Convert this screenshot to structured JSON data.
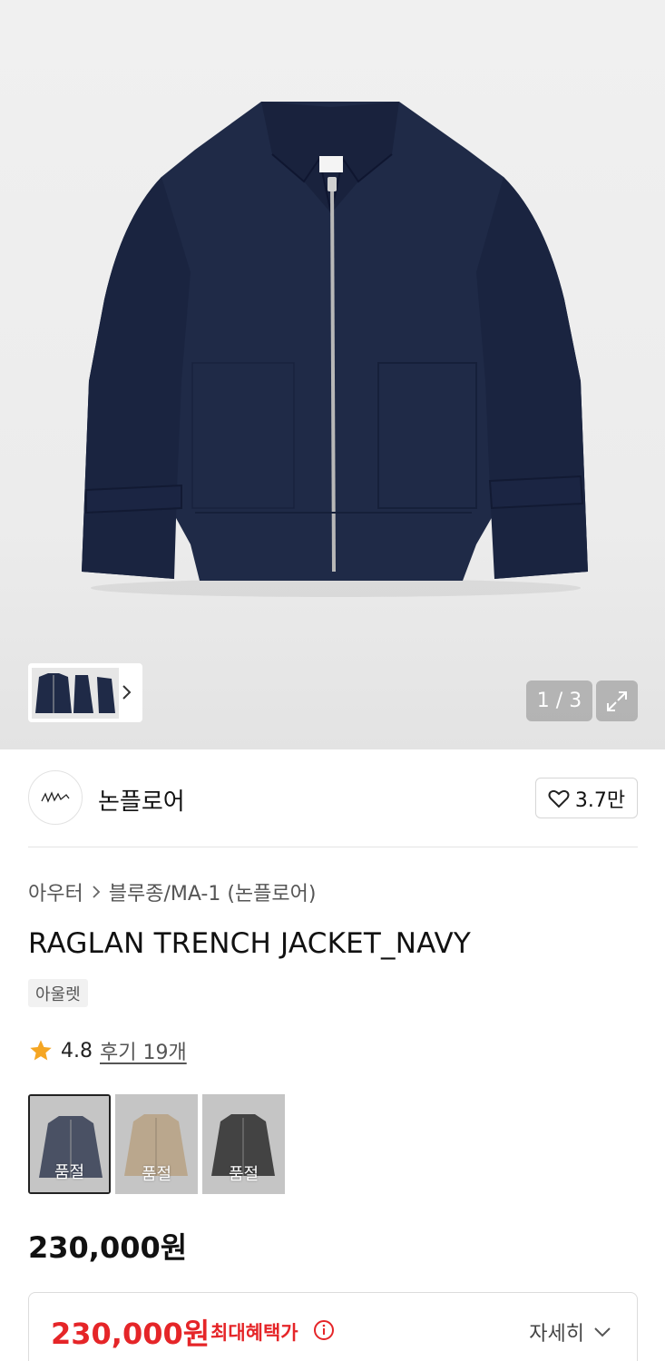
{
  "gallery": {
    "counter": "1 / 3",
    "thumbnails": [
      "jacket-front",
      "jacket-side",
      "jacket-back"
    ]
  },
  "brand": {
    "name": "논플로어",
    "likes": "3.7만"
  },
  "breadcrumb": {
    "category": "아우터",
    "subcategory": "블루종/MA-1 (논플로어)"
  },
  "product": {
    "title": "RAGLAN TRENCH JACKET_NAVY",
    "tag": "아울렛",
    "rating": "4.8",
    "reviews": "후기 19개",
    "price": "230,000원"
  },
  "colors": [
    {
      "name": "navy",
      "swatch": "#1c2744",
      "status": "품절",
      "selected": true
    },
    {
      "name": "beige",
      "swatch": "#c8ab83",
      "status": "품절",
      "selected": false
    },
    {
      "name": "black",
      "swatch": "#121212",
      "status": "품절",
      "selected": false
    }
  ],
  "benefit": {
    "price": "230,000원",
    "label": "최대혜택가",
    "detail": "자세히"
  },
  "theme": {
    "accent_red": "#e52528",
    "star": "#f5a623"
  }
}
